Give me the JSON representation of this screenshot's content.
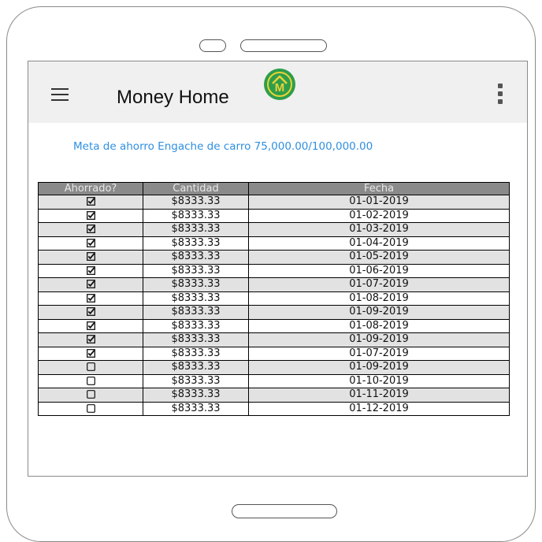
{
  "app": {
    "title": "Money Home",
    "logo_letter": "M",
    "colors": {
      "logo_green": "#2e9e4a",
      "logo_yellow": "#e8d23a",
      "goal_blue": "#2f8fe0",
      "header_gray": "#8a8a8a"
    }
  },
  "goal_text": "Meta de ahorro Engache de carro 75,000.00/100,000.00",
  "table": {
    "headers": [
      "Ahorrado?",
      "Cantidad",
      "Fecha"
    ],
    "rows": [
      {
        "saved": true,
        "amount": "$8333.33",
        "date": "01-01-2019"
      },
      {
        "saved": true,
        "amount": "$8333.33",
        "date": "01-02-2019"
      },
      {
        "saved": true,
        "amount": "$8333.33",
        "date": "01-03-2019"
      },
      {
        "saved": true,
        "amount": "$8333.33",
        "date": "01-04-2019"
      },
      {
        "saved": true,
        "amount": "$8333.33",
        "date": "01-05-2019"
      },
      {
        "saved": true,
        "amount": "$8333.33",
        "date": "01-06-2019"
      },
      {
        "saved": true,
        "amount": "$8333.33",
        "date": "01-07-2019"
      },
      {
        "saved": true,
        "amount": "$8333.33",
        "date": "01-08-2019"
      },
      {
        "saved": true,
        "amount": "$8333.33",
        "date": "01-09-2019"
      },
      {
        "saved": true,
        "amount": "$8333.33",
        "date": "01-08-2019"
      },
      {
        "saved": true,
        "amount": "$8333.33",
        "date": "01-09-2019"
      },
      {
        "saved": true,
        "amount": "$8333.33",
        "date": "01-07-2019"
      },
      {
        "saved": false,
        "amount": "$8333.33",
        "date": "01-09-2019"
      },
      {
        "saved": false,
        "amount": "$8333.33",
        "date": "01-10-2019"
      },
      {
        "saved": false,
        "amount": "$8333.33",
        "date": "01-11-2019"
      },
      {
        "saved": false,
        "amount": "$8333.33",
        "date": "01-12-2019"
      }
    ]
  },
  "icons": {
    "menu": "hamburger-menu-icon",
    "more": "more-vertical-icon",
    "checked": "checked-checkbox-icon",
    "unchecked": "unchecked-checkbox-icon"
  }
}
